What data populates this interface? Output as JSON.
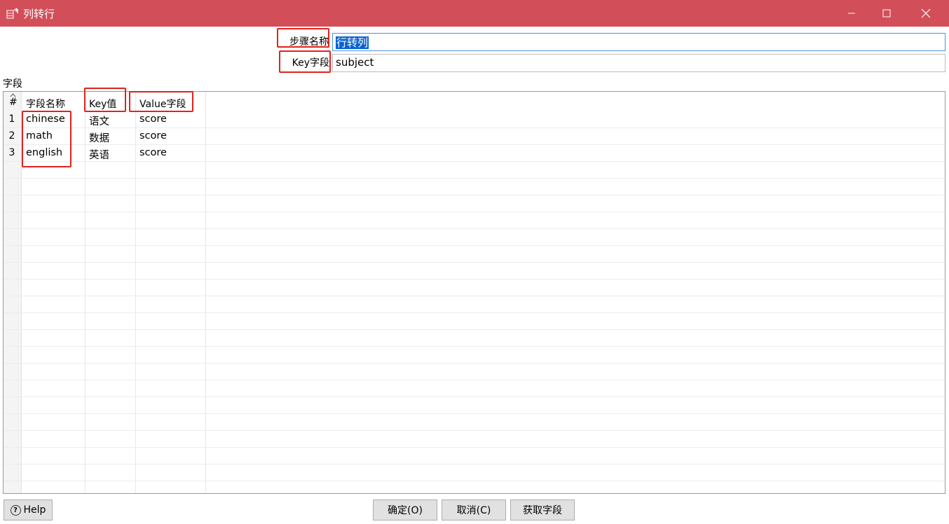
{
  "window": {
    "title": "列转行"
  },
  "form": {
    "step_name_label": "步骤名称",
    "step_name_value": "行转列",
    "key_field_label": "Key字段",
    "key_field_value": "subject"
  },
  "fields_section": {
    "label": "字段",
    "columns": [
      "#",
      "字段名称",
      "Key值",
      "Value字段"
    ],
    "rows": [
      {
        "index": "1",
        "field_name": "chinese",
        "key_value": "语文",
        "value_field": "score"
      },
      {
        "index": "2",
        "field_name": "math",
        "key_value": "数据",
        "value_field": "score"
      },
      {
        "index": "3",
        "field_name": "english",
        "key_value": "英语",
        "value_field": "score"
      }
    ]
  },
  "buttons": {
    "help": "Help",
    "ok": "确定(O)",
    "cancel": "取消(C)",
    "get_fields": "获取字段"
  },
  "colors": {
    "titlebar": "#d24e59",
    "highlight": "#e1221c",
    "selection": "#0a64d0"
  },
  "icons": {
    "app": "table-transform-icon",
    "minimize": "minimize-icon",
    "maximize": "maximize-icon",
    "close": "close-icon",
    "help": "help-icon",
    "sort": "sort-arrow-icon"
  }
}
